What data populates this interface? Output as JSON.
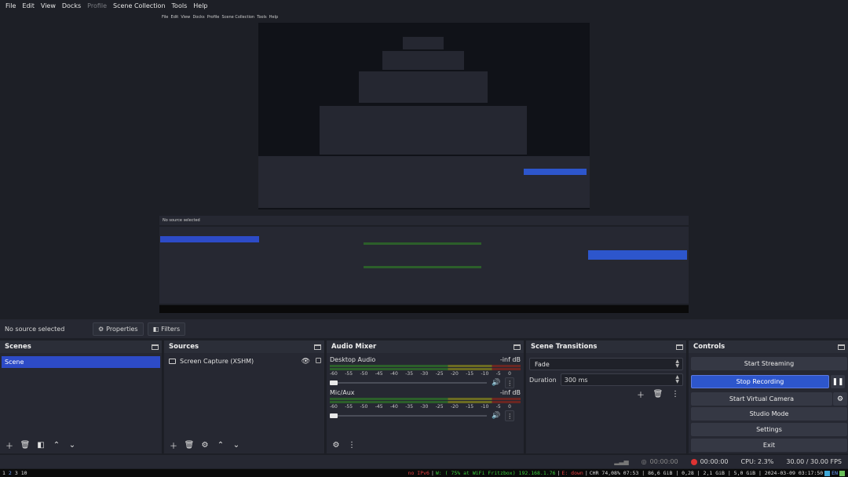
{
  "menubar": {
    "items": [
      {
        "label": "File",
        "disabled": false
      },
      {
        "label": "Edit",
        "disabled": false
      },
      {
        "label": "View",
        "disabled": false
      },
      {
        "label": "Docks",
        "disabled": false
      },
      {
        "label": "Profile",
        "disabled": true
      },
      {
        "label": "Scene Collection",
        "disabled": false
      },
      {
        "label": "Tools",
        "disabled": false
      },
      {
        "label": "Help",
        "disabled": false
      }
    ]
  },
  "source_toolbar": {
    "no_source": "No source selected",
    "properties": "Properties",
    "filters": "Filters"
  },
  "scenes": {
    "title": "Scenes",
    "items": [
      "Scene"
    ]
  },
  "sources": {
    "title": "Sources",
    "items": [
      "Screen Capture (XSHM)"
    ]
  },
  "mixer": {
    "title": "Audio Mixer",
    "channels": [
      {
        "name": "Desktop Audio",
        "level": "-inf dB"
      },
      {
        "name": "Mic/Aux",
        "level": "-inf dB"
      }
    ],
    "ticks": [
      "-60",
      "-55",
      "-50",
      "-45",
      "-40",
      "-35",
      "-30",
      "-25",
      "-20",
      "-15",
      "-10",
      "-5",
      "0"
    ]
  },
  "transitions": {
    "title": "Scene Transitions",
    "selected": "Fade",
    "duration_label": "Duration",
    "duration_value": "300 ms"
  },
  "controls": {
    "title": "Controls",
    "start_streaming": "Start Streaming",
    "stop_recording": "Stop Recording",
    "start_virtual_camera": "Start Virtual Camera",
    "studio_mode": "Studio Mode",
    "settings": "Settings",
    "exit": "Exit"
  },
  "status": {
    "stream_time": "00:00:00",
    "rec_time": "00:00:00",
    "cpu": "CPU: 2.3%",
    "fps": "30.00 / 30.00 FPS"
  },
  "taskbar": {
    "workspaces": [
      "1",
      "2",
      "3",
      "10"
    ],
    "no_ipv6": "no IPv6",
    "wifi": "W: ( 75% at WiFi Fritzbox) 192.168.1.76",
    "eth": "E: down",
    "stats": "CHR 74,08% 07:53 | 86,6 GiB | 0,28 | 2,1 GiB | 5,0 GiB | 2024-03-09 03:17:50",
    "lang": "EN"
  },
  "colors": {
    "accent": "#2d56cc",
    "scene_selected": "#2d4bc7",
    "panel": "#262832",
    "background": "#1d1f26"
  }
}
